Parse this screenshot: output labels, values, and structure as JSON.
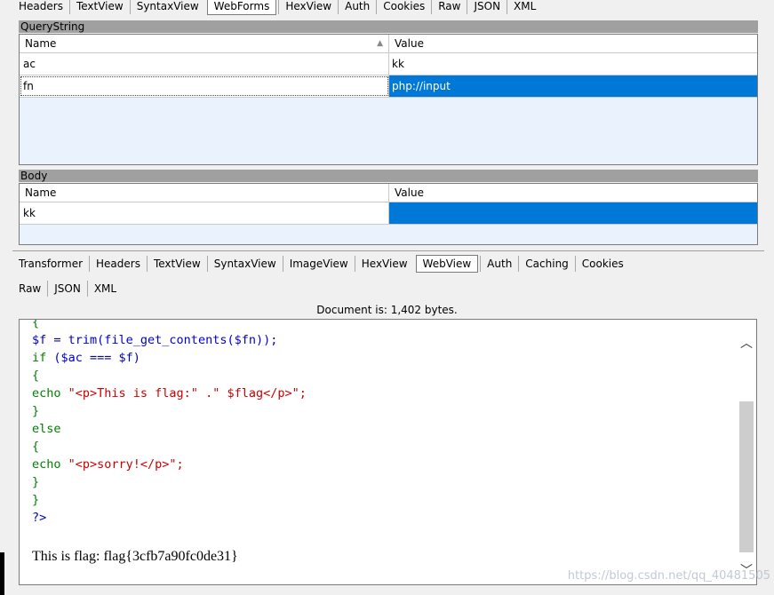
{
  "top_tabs": [
    "Headers",
    "TextView",
    "SyntaxView",
    "WebForms",
    "HexView",
    "Auth",
    "Cookies",
    "Raw",
    "JSON",
    "XML"
  ],
  "top_active_tab": "WebForms",
  "querystring": {
    "title": "QueryString",
    "col_name": "Name",
    "col_value": "Value",
    "rows": [
      {
        "name": "ac",
        "value": "kk"
      },
      {
        "name": "fn",
        "value": "php://input"
      }
    ]
  },
  "body_section": {
    "title": "Body",
    "col_name": "Name",
    "col_value": "Value",
    "rows": [
      {
        "name": "kk",
        "value": ""
      }
    ]
  },
  "response_tabs_row1": [
    "Transformer",
    "Headers",
    "TextView",
    "SyntaxView",
    "ImageView",
    "HexView",
    "WebView",
    "Auth",
    "Caching",
    "Cookies"
  ],
  "response_tabs_row2": [
    "Raw",
    "JSON",
    "XML"
  ],
  "response_active_tab": "WebView",
  "document_info": "Document is: 1,402 bytes.",
  "code": {
    "l0": "{",
    "l1a": "$f = ",
    "l1b": "trim(file_get_contents($fn));",
    "l2a": "if ",
    "l2b": "($ac === $f)",
    "l3": "{",
    "l4a": "echo ",
    "l4b": "\"<p>This is flag:\" .\" $flag</p>\";",
    "l5": "}",
    "l6": "else",
    "l7": "{",
    "l8a": "echo ",
    "l8b": "\"<p>sorry!</p>\";",
    "l9": "}",
    "l10": "}",
    "l11": "?>"
  },
  "flag_output": "This is flag: flag{3cfb7a90fc0de31}",
  "watermark": "https://blog.csdn.net/qq_40481505",
  "colors": {
    "selection": "#0078d7",
    "section_header": "#a0a0a0",
    "grid_bg": "#eaf3fd"
  }
}
